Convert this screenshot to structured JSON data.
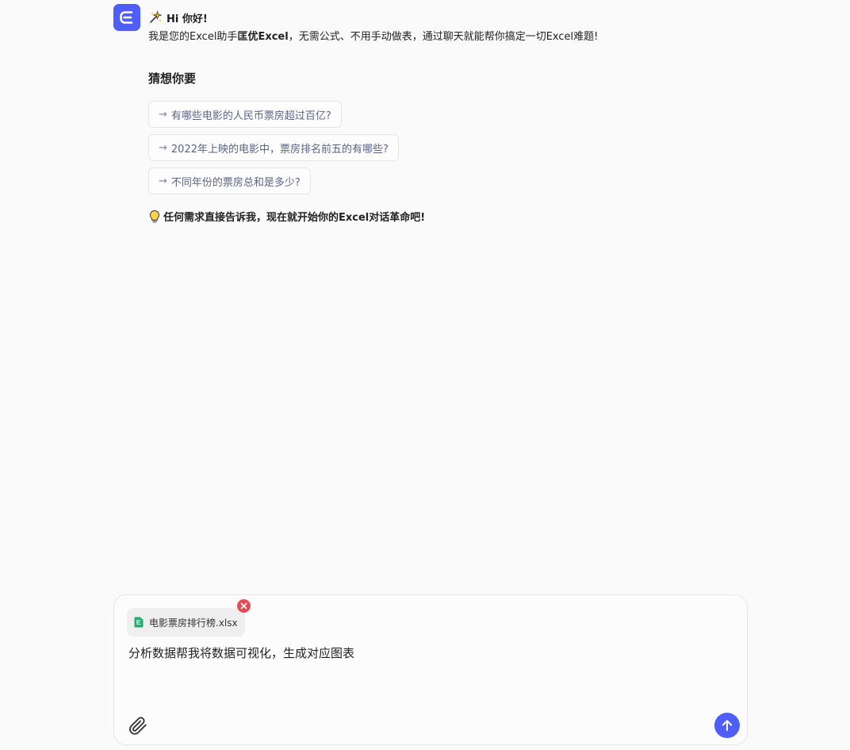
{
  "assistant": {
    "avatar_icon": "excel-e-logo-icon",
    "brand_color": "#4e5ef7",
    "greeting": "Hi 你好!",
    "intro_prefix": "我是您的Excel助手",
    "intro_brand": "匡优Excel",
    "intro_suffix": "，无需公式、不用手动做表，通过聊天就能帮你搞定一切Excel难题!",
    "guess_title": "猜想你要",
    "suggestions": [
      {
        "label": "有哪些电影的人民币票房超过百亿?"
      },
      {
        "label": "2022年上映的电影中，票房排名前五的有哪些?"
      },
      {
        "label": "不同年份的票房总和是多少?"
      }
    ],
    "suggestion_arrow": "→",
    "tip": "任何需求直接告诉我，现在就开始你的Excel对话革命吧!"
  },
  "composer": {
    "attachment": {
      "filename": "电影票房排行榜.xlsx",
      "icon": "excel-file-icon"
    },
    "text": "分析数据帮我将数据可视化，生成对应图表",
    "remove_color": "#e84a55",
    "send_color": "#4e5ef7"
  }
}
